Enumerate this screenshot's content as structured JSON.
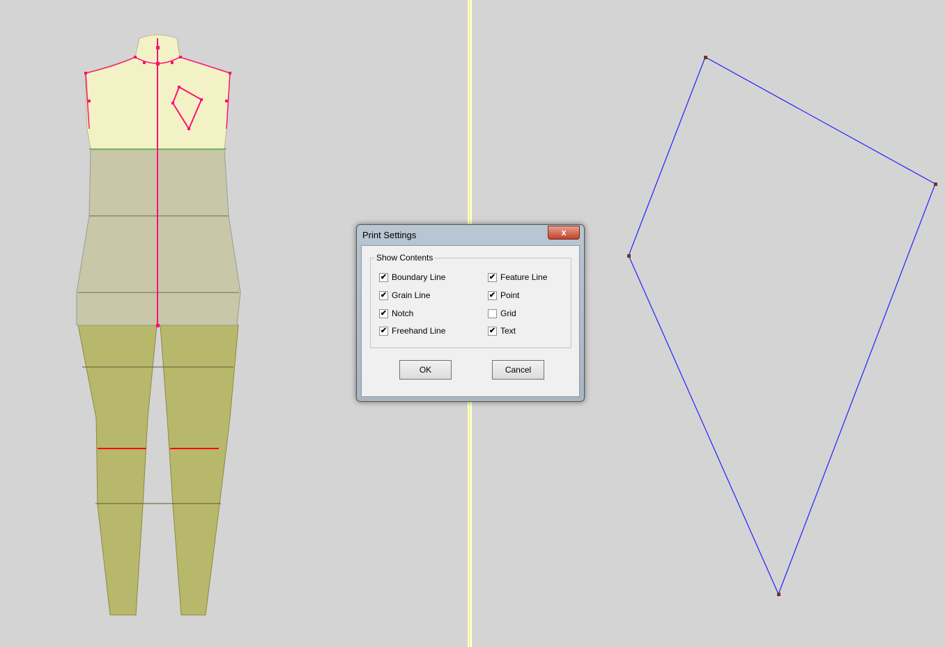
{
  "dialog": {
    "title": "Print Settings",
    "close_label": "x",
    "group_label": "Show Contents",
    "options": [
      {
        "label": "Boundary Line",
        "checked": true
      },
      {
        "label": "Feature Line",
        "checked": true
      },
      {
        "label": "Grain Line",
        "checked": true
      },
      {
        "label": "Point",
        "checked": true
      },
      {
        "label": "Notch",
        "checked": true
      },
      {
        "label": "Grid",
        "checked": false
      },
      {
        "label": "Freehand Line",
        "checked": true
      },
      {
        "label": "Text",
        "checked": true
      }
    ],
    "ok_label": "OK",
    "cancel_label": "Cancel"
  },
  "colors": {
    "pattern_line": "#2020ff",
    "pattern_point": "#6b3a1a",
    "mannequin_line": "#ff1070"
  }
}
